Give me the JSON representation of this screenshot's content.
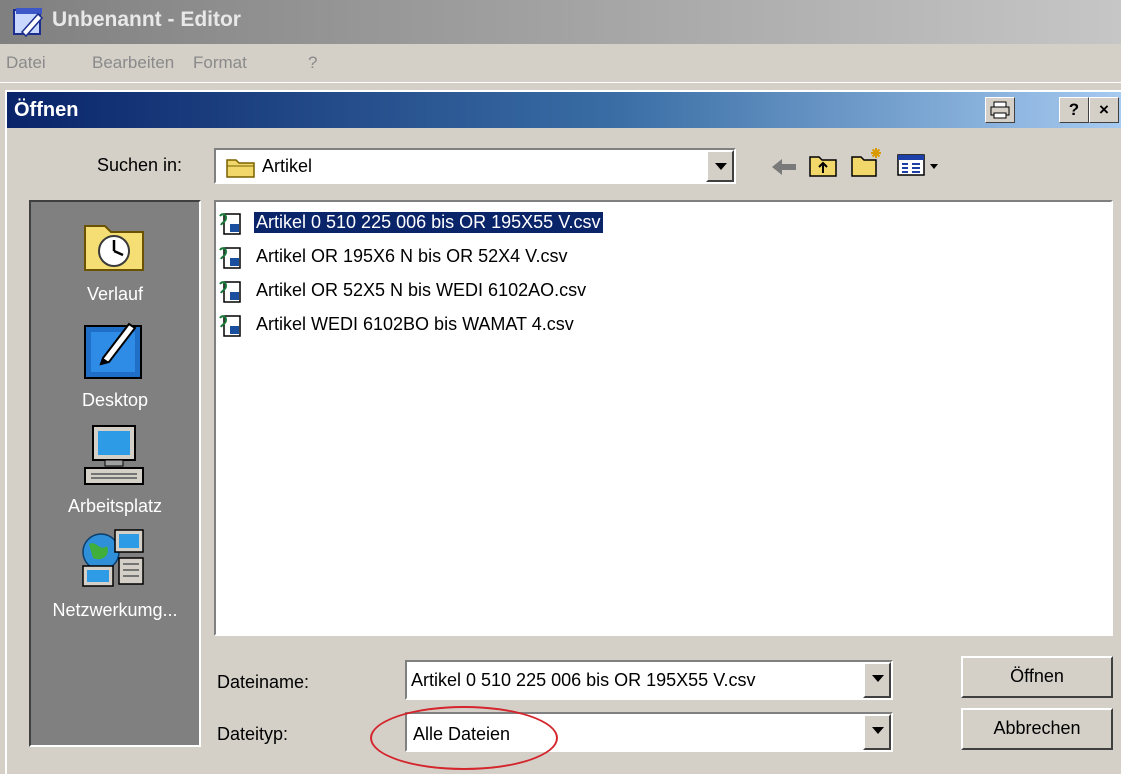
{
  "editor": {
    "title": "Unbenannt - Editor",
    "menu": [
      "Datei",
      "Bearbeiten",
      "Format",
      "?"
    ]
  },
  "dialog": {
    "title": "Öffnen",
    "title_buttons": {
      "help": "?",
      "close": "×"
    },
    "look_in_label": "Suchen in:",
    "look_in_value": "Artikel",
    "toolbar_icons": [
      "back-arrow-icon",
      "up-folder-icon",
      "new-folder-icon",
      "view-menu-icon"
    ],
    "places": [
      {
        "label": "Verlauf",
        "icon": "history-icon"
      },
      {
        "label": "Desktop",
        "icon": "desktop-icon"
      },
      {
        "label": "Arbeitsplatz",
        "icon": "my-computer-icon"
      },
      {
        "label": "Netzwerkumg...",
        "icon": "network-icon"
      }
    ],
    "files": [
      {
        "name": "Artikel 0 510 225 006 bis OR 195X55 V.csv",
        "selected": true
      },
      {
        "name": "Artikel OR 195X6 N bis OR 52X4 V.csv",
        "selected": false
      },
      {
        "name": "Artikel OR 52X5 N bis WEDI 6102AO.csv",
        "selected": false
      },
      {
        "name": "Artikel WEDI 6102BO bis WAMAT 4.csv",
        "selected": false
      }
    ],
    "filename_label": "Dateiname:",
    "filename_value": "Artikel 0 510 225 006 bis OR 195X55 V.csv",
    "filetype_label": "Dateityp:",
    "filetype_value": "Alle Dateien",
    "open_button": "Öffnen",
    "cancel_button": "Abbrechen"
  },
  "colors": {
    "selection": "#0a246a",
    "annotation": "#d4242c",
    "dialog_face": "#d4d0c8"
  }
}
